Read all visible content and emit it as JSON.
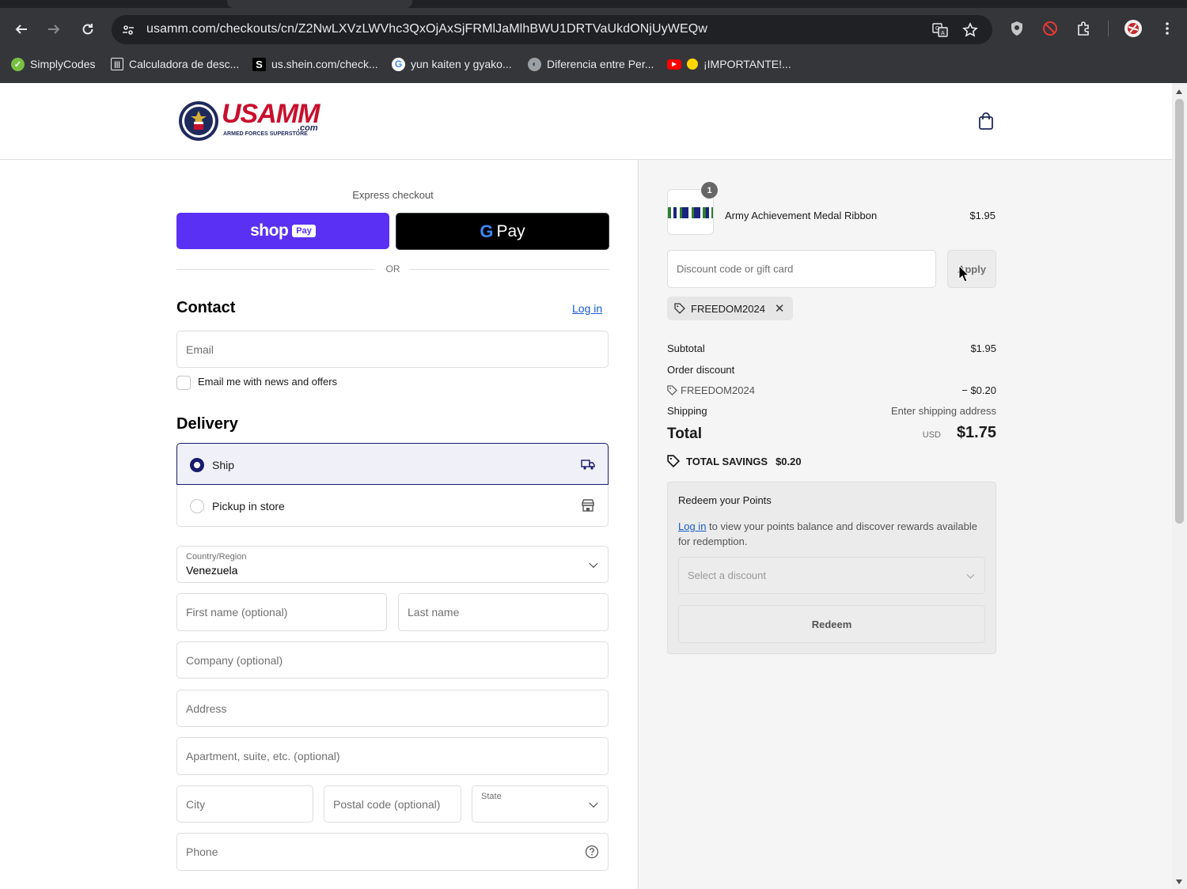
{
  "browser": {
    "url": "usamm.com/checkouts/cn/Z2NwLXVzLWVhc3QxOjAxSjFRMlJaMlhBWU1DRTVaUkdONjUyWEQw",
    "bookmarks": [
      {
        "label": "SimplyCodes",
        "icon": "simplycodes-icon"
      },
      {
        "label": "Calculadora de desc...",
        "icon": "calculator-icon"
      },
      {
        "label": "us.shein.com/check...",
        "icon": "shein-icon"
      },
      {
        "label": "yun kaiten y gyako...",
        "icon": "google-icon"
      },
      {
        "label": "Diferencia entre Per...",
        "icon": "globe-icon"
      },
      {
        "label": "¡IMPORTANTE!...",
        "icon": "youtube-icon"
      }
    ]
  },
  "header": {
    "logo_text": "USAMM",
    "logo_sub": ".com",
    "logo_tag": "ARMED FORCES SUPERSTORE"
  },
  "express": {
    "label": "Express checkout",
    "shoppay_word": "shop",
    "shoppay_pay": "Pay",
    "gpay_g": "G",
    "gpay_pay": "Pay",
    "or": "OR"
  },
  "contact": {
    "title": "Contact",
    "login": "Log in",
    "email_placeholder": "Email",
    "newsletter_label": "Email me with news and offers"
  },
  "delivery": {
    "title": "Delivery",
    "options": [
      {
        "label": "Ship",
        "selected": true,
        "icon": "truck-icon"
      },
      {
        "label": "Pickup in store",
        "selected": false,
        "icon": "store-icon"
      }
    ],
    "country_label": "Country/Region",
    "country_value": "Venezuela",
    "first_name": "First name (optional)",
    "last_name": "Last name",
    "company": "Company (optional)",
    "address": "Address",
    "apartment": "Apartment, suite, etc. (optional)",
    "city": "City",
    "postal": "Postal code (optional)",
    "state_label": "State",
    "phone": "Phone"
  },
  "summary": {
    "product": {
      "name": "Army Achievement Medal Ribbon",
      "price": "$1.95",
      "quantity": "1"
    },
    "discount_placeholder": "Discount code or gift card",
    "apply": "Apply",
    "applied_code": "FREEDOM2024",
    "subtotal_label": "Subtotal",
    "subtotal": "$1.95",
    "order_discount_label": "Order discount",
    "discount_code": "FREEDOM2024",
    "discount_amount": "− $0.20",
    "shipping_label": "Shipping",
    "shipping_value": "Enter shipping address",
    "total_label": "Total",
    "currency": "USD",
    "total": "$1.75",
    "savings_label": "TOTAL SAVINGS",
    "savings_amount": "$0.20"
  },
  "points": {
    "title": "Redeem your Points",
    "login": "Log in",
    "desc": " to view your points balance and discover rewards available for redemption.",
    "select_placeholder": "Select a discount",
    "redeem": "Redeem"
  },
  "colors": {
    "shoppay": "#5a31f4",
    "selected_border": "#1a1a6e",
    "link": "#1a5ad0",
    "logo_red": "#c8102e",
    "logo_navy": "#1f2a5c"
  }
}
